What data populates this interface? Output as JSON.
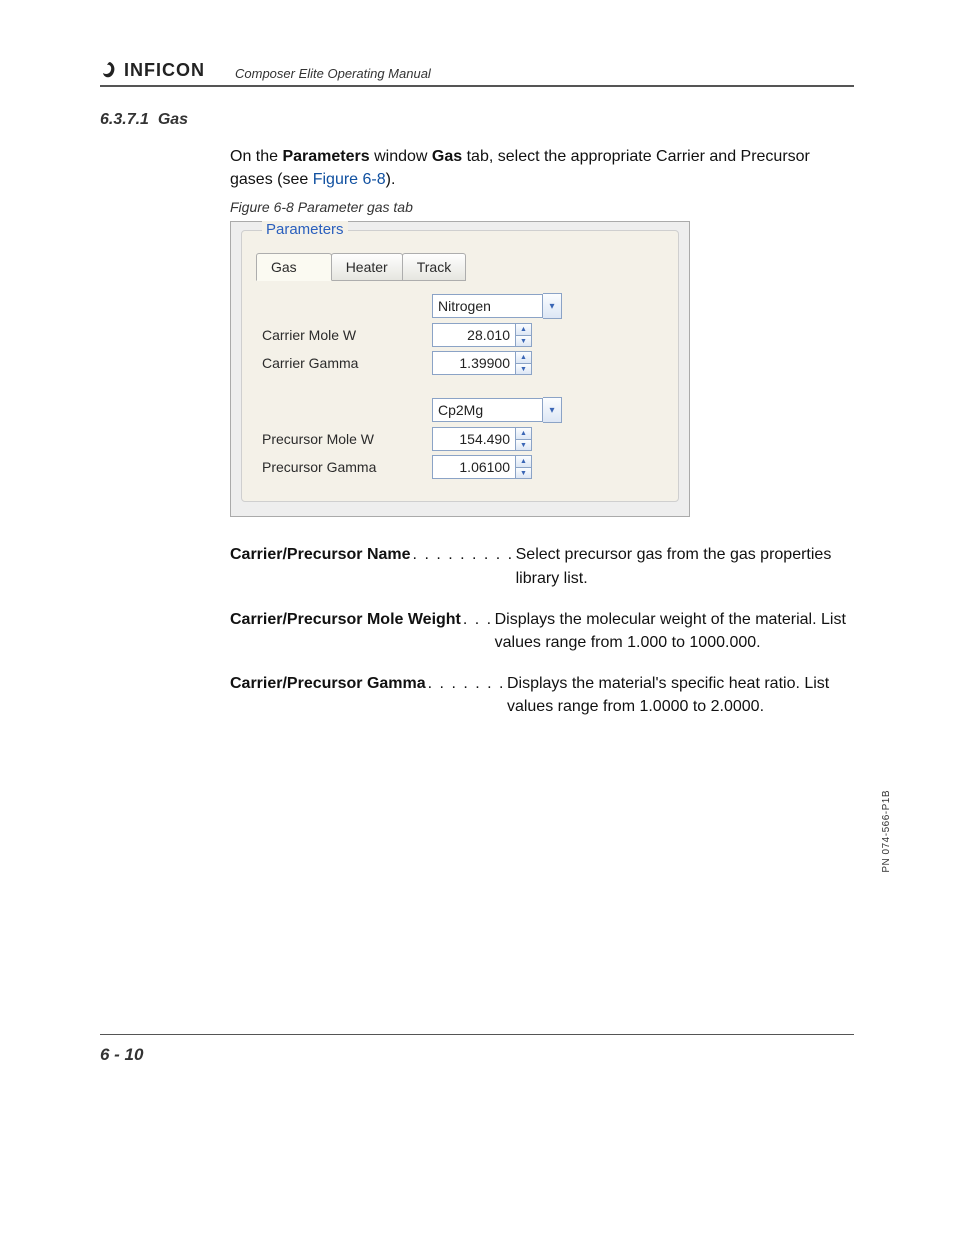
{
  "header": {
    "brand": "INFICON",
    "manual_title": "Composer Elite Operating Manual"
  },
  "section": {
    "number": "6.3.7.1",
    "title": "Gas"
  },
  "intro": {
    "pre": "On the ",
    "b1": "Parameters",
    "mid": " window ",
    "b2": "Gas",
    "post": " tab, select the appropriate Carrier and Precursor gases (see ",
    "link": "Figure 6-8",
    "end": ")."
  },
  "figure": {
    "caption": "Figure 6-8  Parameter gas tab",
    "groupTitle": "Parameters",
    "tabs": [
      "Gas",
      "Heater",
      "Track"
    ],
    "carrier": {
      "select": "Nitrogen",
      "moleLabel": "Carrier Mole W",
      "moleValue": "28.010",
      "gammaLabel": "Carrier Gamma",
      "gammaValue": "1.39900"
    },
    "precursor": {
      "select": "Cp2Mg",
      "moleLabel": "Precursor Mole W",
      "moleValue": "154.490",
      "gammaLabel": "Precursor Gamma",
      "gammaValue": "1.06100"
    }
  },
  "defs": [
    {
      "term": "Carrier/Precursor Name",
      "dots": ". . . . . . . . .",
      "desc": "Select precursor gas from the gas properties library list."
    },
    {
      "term": "Carrier/Precursor Mole Weight",
      "dots": " . . .",
      "desc": "Displays the molecular weight of the material. List values range from 1.000 to 1000.000."
    },
    {
      "term": "Carrier/Precursor Gamma",
      "dots": " . . . . . . .",
      "desc": "Displays the material's specific heat ratio. List values range from 1.0000 to 2.0000."
    }
  ],
  "side_pn": "PN 074-566-P1B",
  "page_number": "6 - 10"
}
